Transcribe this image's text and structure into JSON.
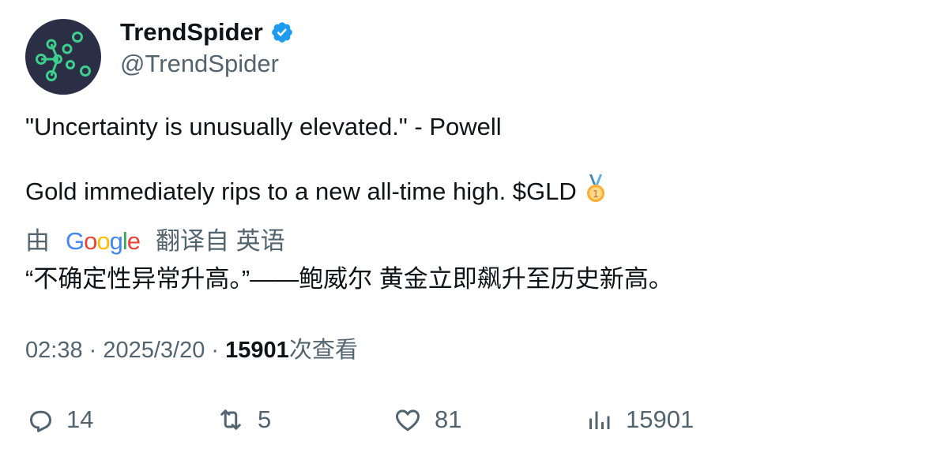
{
  "author": {
    "display_name": "TrendSpider",
    "handle": "@TrendSpider",
    "verified_icon": "verified-badge-icon",
    "avatar_icon": "trendspider-logo-icon"
  },
  "tweet": {
    "line1": "\"Uncertainty is unusually elevated.\" - Powell",
    "line2": "Gold immediately rips to a new all-time high.  $GLD",
    "emoji": "🥇"
  },
  "translation": {
    "by_label": "由",
    "provider": "Google",
    "from_label": "翻译自 英语",
    "text": "“不确定性异常升高。”——鲍威尔 黄金立即飙升至历史新高。"
  },
  "meta": {
    "time": "02:38",
    "sep1": " · ",
    "date": "2025/3/20",
    "sep2": " · ",
    "views_count": "15901",
    "views_label": "次查看"
  },
  "actions": {
    "replies": "14",
    "retweets": "5",
    "likes": "81",
    "views": "15901"
  },
  "colors": {
    "text": "#0f1419",
    "muted": "#536471",
    "verified": "#1d9bf0",
    "avatar_bg": "#2b2f45",
    "avatar_accent": "#3ecf8e"
  }
}
